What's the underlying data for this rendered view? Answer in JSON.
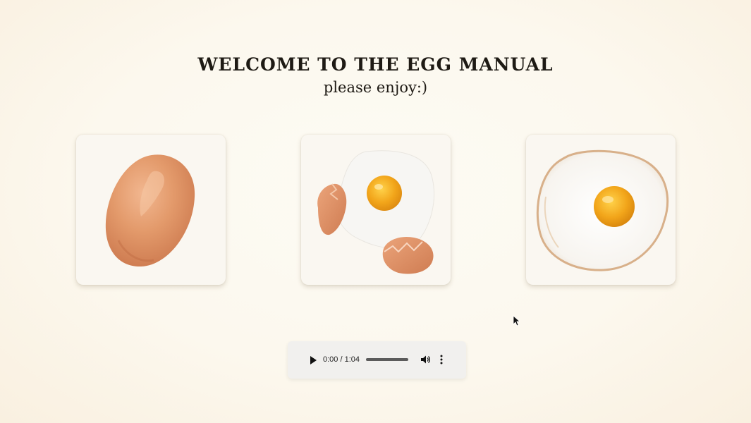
{
  "header": {
    "title": "WELCOME TO THE EGG MANUAL",
    "subtitle": "please enjoy:)"
  },
  "cards": [
    {
      "name": "whole-egg",
      "icon": "brown-egg-icon"
    },
    {
      "name": "cracked-egg",
      "icon": "cracked-egg-icon"
    },
    {
      "name": "fried-egg",
      "icon": "fried-egg-icon"
    }
  ],
  "audio_player": {
    "current_time": "0:00",
    "separator": " / ",
    "duration": "1:04",
    "progress": 0,
    "play_icon": "play-icon",
    "volume_icon": "volume-icon",
    "more_icon": "more-options-icon"
  },
  "colors": {
    "shell": "#e39a6b",
    "yolk": "#f2a51a",
    "white": "#ffffff",
    "title_text": "#1e1a14"
  }
}
